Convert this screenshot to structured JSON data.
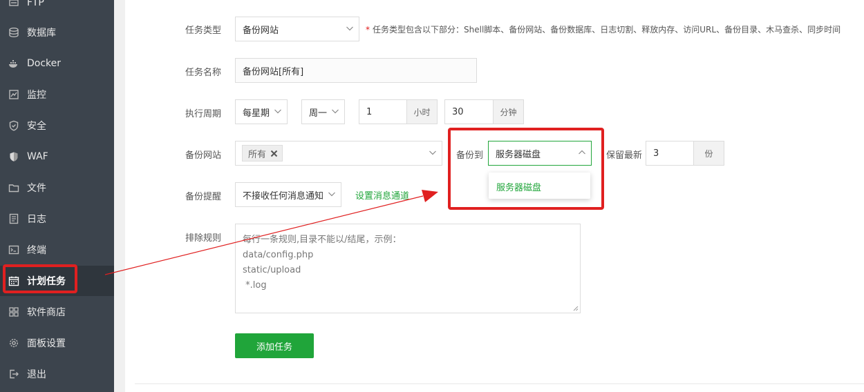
{
  "sidebar": {
    "items": [
      {
        "label": "FTP",
        "icon": "ftp-icon"
      },
      {
        "label": "数据库",
        "icon": "database-icon"
      },
      {
        "label": "Docker",
        "icon": "docker-icon"
      },
      {
        "label": "监控",
        "icon": "monitor-icon"
      },
      {
        "label": "安全",
        "icon": "shield-icon"
      },
      {
        "label": "WAF",
        "icon": "waf-shield-icon"
      },
      {
        "label": "文件",
        "icon": "folder-icon"
      },
      {
        "label": "日志",
        "icon": "log-icon"
      },
      {
        "label": "终端",
        "icon": "terminal-icon"
      },
      {
        "label": "计划任务",
        "icon": "calendar-icon"
      },
      {
        "label": "软件商店",
        "icon": "grid-icon"
      },
      {
        "label": "面板设置",
        "icon": "gear-icon"
      },
      {
        "label": "退出",
        "icon": "logout-icon"
      }
    ]
  },
  "form": {
    "task_type": {
      "label": "任务类型",
      "value": "备份网站",
      "hint": "任务类型包含以下部分：Shell脚本、备份网站、备份数据库、日志切割、释放内存、访问URL、备份目录、木马查杀、同步时间"
    },
    "task_name": {
      "label": "任务名称",
      "value": "备份网站[所有]"
    },
    "period": {
      "label": "执行周期",
      "unit": "每星期",
      "weekday": "周一",
      "hour": "1",
      "hour_unit": "小时",
      "minute": "30",
      "minute_unit": "分钟"
    },
    "backup_site": {
      "label": "备份网站",
      "tag": "所有"
    },
    "backup_to": {
      "label": "备份到",
      "value": "服务器磁盘",
      "option": "服务器磁盘"
    },
    "keep_latest": {
      "label": "保留最新",
      "value": "3",
      "unit": "份"
    },
    "remind": {
      "label": "备份提醒",
      "value": "不接收任何消息通知",
      "link": "设置消息通道"
    },
    "exclude": {
      "label": "排除规则",
      "placeholder_lines": [
        "每行一条规则,目录不能以/结尾，示例：",
        "data/config.php",
        "static/upload",
        " *.log"
      ]
    },
    "submit": "添加任务"
  },
  "colors": {
    "sidebar_bg": "#3c444d",
    "accent_green": "#20a53a",
    "annotation_red": "#e02020"
  }
}
